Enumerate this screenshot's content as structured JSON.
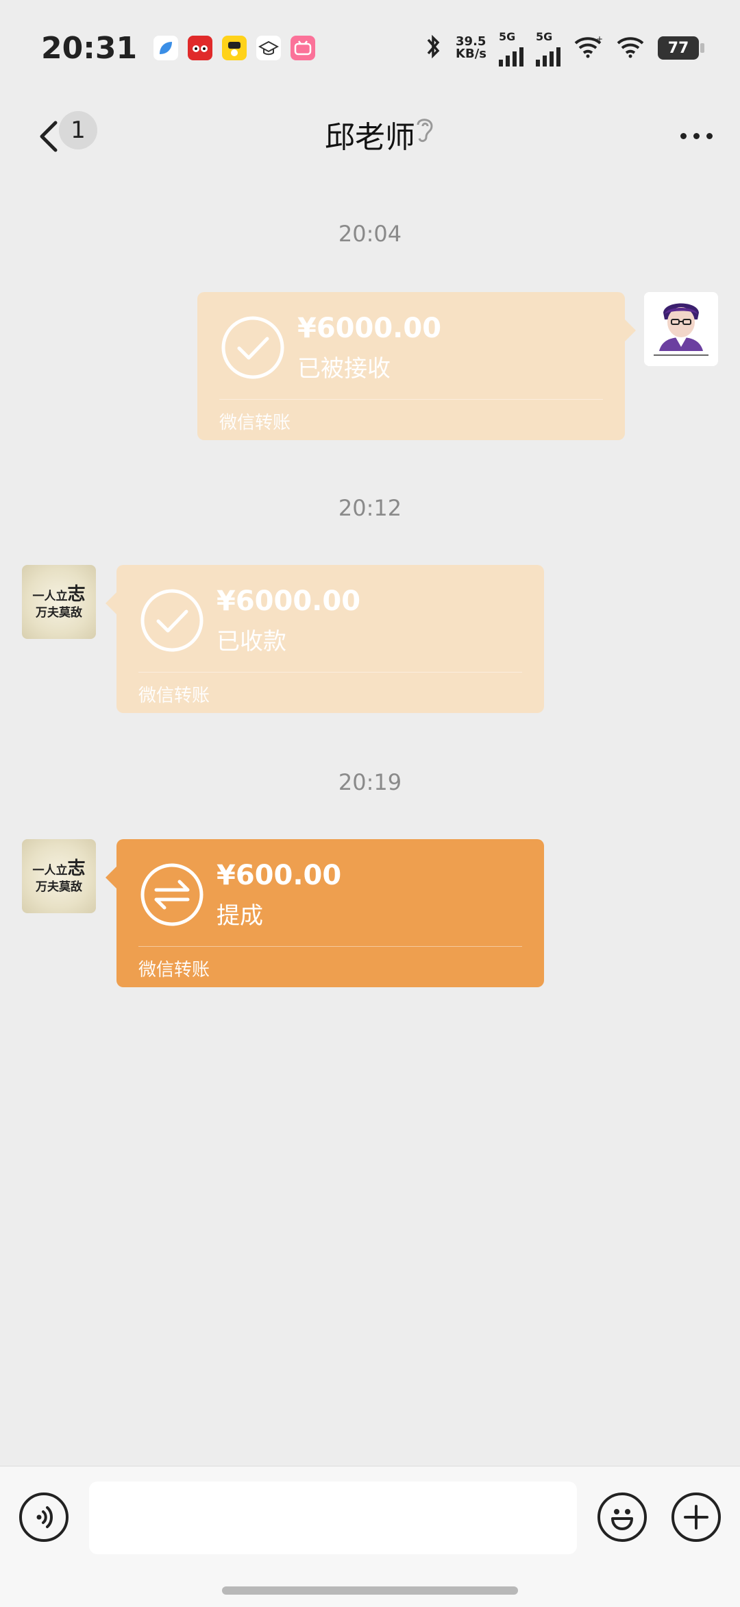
{
  "status_bar": {
    "time": "20:31",
    "net_speed_value": "39.5",
    "net_speed_unit": "KB/s",
    "signal1_label": "5G",
    "signal2_label": "5G",
    "battery": "77",
    "app_icons": [
      "leaf-app-icon",
      "tmall-app-icon",
      "meituan-app-icon",
      "graduation-cap-app-icon",
      "bilibili-app-icon"
    ]
  },
  "nav": {
    "unread_count": "1",
    "title": "邱老师"
  },
  "messages": [
    {
      "time": "20:04",
      "side": "right",
      "amount": "¥6000.00",
      "status": "已被接收",
      "footer": "微信转账",
      "icon": "check-circle-icon"
    },
    {
      "time": "20:12",
      "side": "left",
      "amount": "¥6000.00",
      "status": "已收款",
      "footer": "微信转账",
      "icon": "check-circle-icon"
    },
    {
      "time": "20:19",
      "side": "left",
      "amount": "¥600.00",
      "status": "提成",
      "footer": "微信转账",
      "icon": "transfer-arrows-icon"
    }
  ],
  "contact_avatar": {
    "line1_a": "一人立",
    "line1_b": "志",
    "line2": "万夫莫敌"
  },
  "input": {
    "value": "",
    "placeholder": ""
  },
  "colors": {
    "received_bubble": "#f7e1c4",
    "pending_bubble": "#ee9f4f",
    "background": "#ededed"
  }
}
